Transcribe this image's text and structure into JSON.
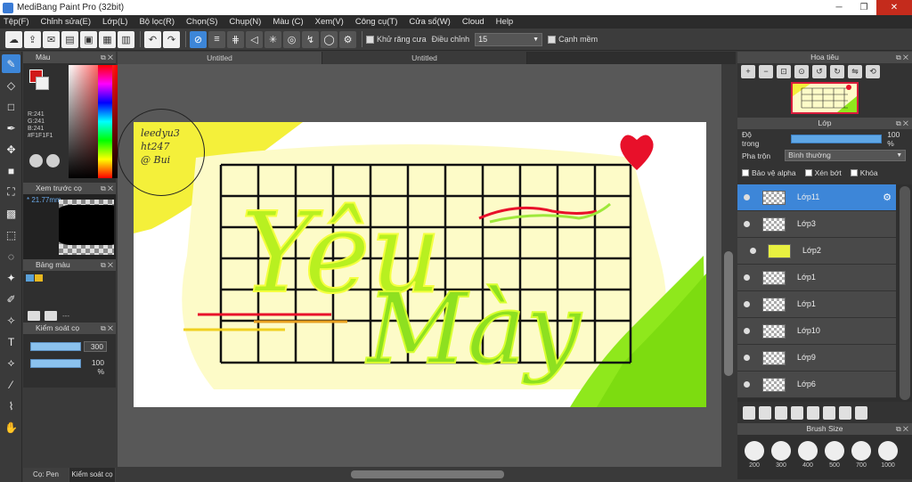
{
  "window": {
    "title": "MediBang Paint Pro (32bit)"
  },
  "menu": [
    "Tệp(F)",
    "Chỉnh sửa(E)",
    "Lớp(L)",
    "Bộ lọc(R)",
    "Chọn(S)",
    "Chụp(N)",
    "Màu (C)",
    "Xem(V)",
    "Công cụ(T)",
    "Cửa sổ(W)",
    "Cloud",
    "Help"
  ],
  "toolbar": {
    "antialias_label": "Khử răng cưa",
    "correction_label": "Điều chỉnh",
    "correction_value": "15",
    "smooth_label": "Cạnh mềm"
  },
  "color_panel": {
    "title": "Màu",
    "r": "R:241",
    "g": "G:241",
    "b": "B:241",
    "hex": "#F1F1F1",
    "fg_color": "#d11a1a",
    "bg_color": "#f1f1f1"
  },
  "brush_preview": {
    "title": "Xem trước cọ",
    "size": "* 21.77mm"
  },
  "palette": {
    "title": "Bảng màu",
    "swatches": [
      "#5aa0d8",
      "#e8b820"
    ],
    "dash": "---"
  },
  "brush_control": {
    "title": "Kiểm soát cọ",
    "size_value": "300",
    "opacity_value": "100 %"
  },
  "bottom_tabs": [
    "Cọ: Pen",
    "Kiểm soát cọ"
  ],
  "doc_tabs": [
    "Untitled",
    "Untitled"
  ],
  "artwork": {
    "signature_lines": [
      "leedyu3",
      "ht247",
      "@ Bui"
    ],
    "words": [
      "Yêu",
      "Mày"
    ]
  },
  "navigator": {
    "title": "Hoa tiêu"
  },
  "layer_panel": {
    "title": "Lớp",
    "opacity_label": "Độ trong",
    "opacity_value": "100 %",
    "blend_label": "Pha trộn",
    "blend_value": "Bình thường",
    "protect_alpha": "Bảo vệ alpha",
    "clip": "Xén bớt",
    "lock": "Khóa",
    "layers": [
      {
        "name": "Lớp11",
        "selected": true
      },
      {
        "name": "Lớp3",
        "selected": false
      },
      {
        "name": "Lớp2",
        "selected": false
      },
      {
        "name": "Lớp1",
        "selected": false
      },
      {
        "name": "Lớp1",
        "selected": false
      },
      {
        "name": "Lớp10",
        "selected": false
      },
      {
        "name": "Lớp9",
        "selected": false
      },
      {
        "name": "Lớp6",
        "selected": false
      }
    ]
  },
  "brush_size": {
    "title": "Brush Size",
    "sizes": [
      "200",
      "300",
      "400",
      "500",
      "700",
      "1000"
    ]
  }
}
